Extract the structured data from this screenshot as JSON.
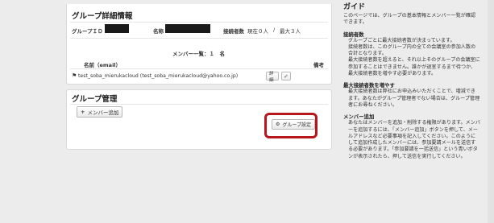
{
  "group_panel": {
    "title": "グループ詳細情報",
    "group_id_label": "グループＩＤ",
    "name_label": "名称",
    "max_connections_label": "接続者数",
    "current_connections": "現在０人",
    "separator": "/",
    "max_connections": "最大３人",
    "members_heading": "メンバー一覧：１　名",
    "col_name_email": "名前（email）",
    "col_notes": "備考",
    "member_row": {
      "flag_icon": "flag-icon",
      "text": "test_soba_mierukacloud (test_soba_mierukacloud@yahoo.co.jp)",
      "detail_button": "詳細",
      "edit_icon": "pencil-icon"
    }
  },
  "management_panel": {
    "title": "グループ管理",
    "add_member_button": "メンバー追加",
    "add_member_icon": "plus-icon",
    "group_settings_button": "グループ設定",
    "group_settings_icon": "gear-icon",
    "highlight_color": "#b5171d"
  },
  "guide": {
    "title": "ガイド",
    "intro": "このページでは、グループの基本情報とメンバー一覧が確認できます。",
    "sections": [
      {
        "heading": "接続者数",
        "body": [
          "グループごとに最大接続者数が決まっています。",
          "接続者数は、このグループ内の全ての会議室の参加人数の合計となります。",
          "最大接続者数を超えると、それ以上そのグループの会議室に参加することはできません。誰かが退室するまで待つか、最大接続者数を増やす必要があります。"
        ]
      },
      {
        "heading": "最大接続者数を増やす",
        "body": [
          "最大接続者数は弊社にお申込みいただくことで、増減できます。あなたがグループ管理者でない場合は、グループ管理者にお尋ねください。"
        ]
      },
      {
        "heading": "メンバー追加",
        "body": [
          "あなたはメンバーを追加・削除する権限があります。メンバーを追加するには、「メンバー追加」ボタンを押して、メールアドレスなど必要事項を記入してください。このようにして追加作成したメンバーには、参加要請メールを送信する必要があります。「参加要請を一括送信」という青いボタンが表示されたら、押して送信を実行してください。"
        ]
      }
    ]
  }
}
